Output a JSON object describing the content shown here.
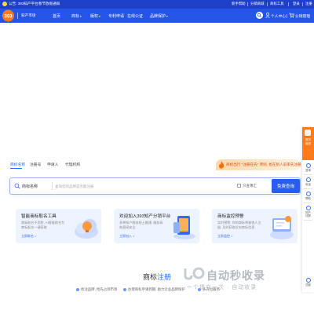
{
  "topbar": {
    "notice": "公告: 393知产平台春节放假通知",
    "links": [
      "新手帮助",
      "分销商城",
      "商标工具",
      "登录",
      "注册"
    ]
  },
  "header": {
    "logo_text": "393",
    "brand": "知产市场",
    "nav": [
      {
        "label": "首页",
        "has_menu": false
      },
      {
        "label": "商标",
        "has_menu": true
      },
      {
        "label": "版权",
        "has_menu": true
      },
      {
        "label": "专利申请",
        "has_menu": false
      },
      {
        "label": "在线公证",
        "has_menu": false
      },
      {
        "label": "品牌保护",
        "has_menu": true
      }
    ],
    "user_center": "个人中心",
    "cart": "分销管理"
  },
  "promo": {
    "text": "商标出行 \"注册在先\" 原则, 抢在别人前率先注册"
  },
  "tabs": [
    {
      "label": "商标名称",
      "active": true
    },
    {
      "label": "注册号",
      "active": false
    },
    {
      "label": "申请人",
      "active": false
    },
    {
      "label": "代理机构",
      "active": false
    }
  ],
  "search": {
    "type_label": "商标名称",
    "placeholder": "查询您的品牌是否能注册",
    "checkbox_label": "只查簿汇",
    "submit_label": "免费查询"
  },
  "cards": [
    {
      "title": "智能商标取名工具",
      "desc": "商标取名不用愁, AI智能取名为商标起名一键获取",
      "link": "立即取名 >"
    },
    {
      "title": "欢迎加入393知产分销平台",
      "desc": "多种知产服务线上融通, 服务高效直接安全",
      "link": "立即加入 >"
    },
    {
      "title": "商标监控预警",
      "desc": "实时预警, 你的商标将被他人注册, 及时获取近似商标信息",
      "link": "立即监控 >"
    }
  ],
  "section": {
    "title_plain": "商标",
    "title_highlight": "注册",
    "features": [
      "抢注品牌, 抢先占领市场",
      "办理商标申请到期, 助力企业品牌保护",
      "多方位服务"
    ]
  },
  "watermark": {
    "title": "自动秒收录",
    "subtitle": "一个提交一次 · 自动收录"
  },
  "rail": {
    "top_label": "服务\n客服",
    "items": [
      "咨询",
      "电话",
      "帮助",
      "知产\n社群",
      "顶部"
    ]
  },
  "colors": {
    "topbar": "#1e3fc8",
    "header": "#2554e8",
    "accent": "#2e6bff",
    "promo": "#e04a0d",
    "rail_top": "#ff7a1a"
  },
  "icons": [
    "notice-icon",
    "logo",
    "search-icon",
    "user-icon",
    "cart-icon",
    "flame-icon",
    "magnifier-icon",
    "rail-service-icon"
  ]
}
